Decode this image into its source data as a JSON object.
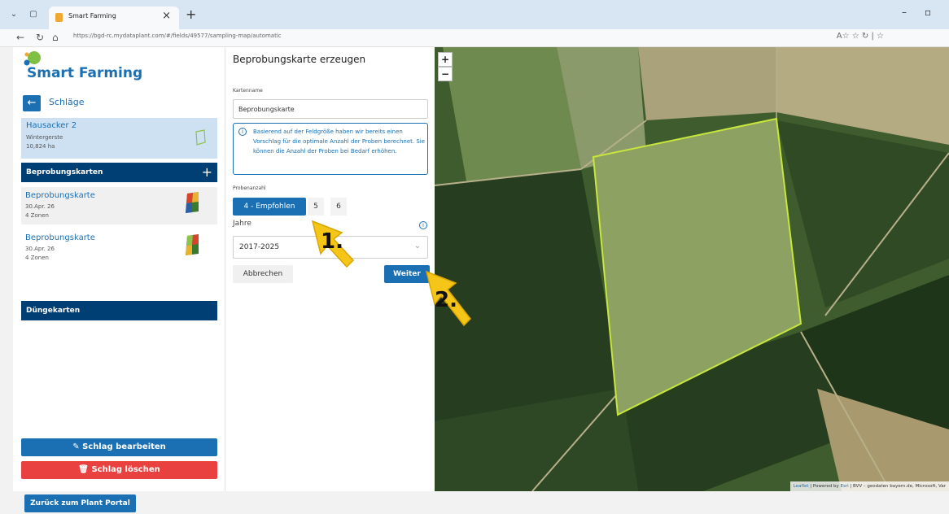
{
  "browser": {
    "tab_title": "Smart Farming",
    "url": "https://bgd-rc.mydataplant.com/#/fields/49577/sampling-map/automatic",
    "tab_close": "×",
    "new_tab": "+"
  },
  "sidebar": {
    "logo_text": "Smart Farming",
    "back_icon": "←",
    "back_label": "Schläge",
    "field": {
      "name": "Hausacker 2",
      "crop": "Wintergerste",
      "area": "10,824 ha"
    },
    "sampling_section": {
      "label": "Beprobungskarten",
      "add": "+"
    },
    "sampling_maps": [
      {
        "title": "Beprobungskarte",
        "date": "30.Apr. 26",
        "zones": "4 Zonen"
      },
      {
        "title": "Beprobungskarte",
        "date": "30.Apr. 26",
        "zones": "4 Zonen"
      }
    ],
    "fertilizer_section": {
      "label": "Düngekarten"
    },
    "edit_button": "Schlag bearbeiten",
    "delete_button": "Schlag löschen"
  },
  "form": {
    "title": "Beprobungskarte erzeugen",
    "name_label": "Kartenname",
    "name_value": "Beprobungskarte",
    "info_text": "Basierend auf der Feldgröße haben wir bereits einen Vorschlag für die optimale Anzahl der Proben berechnet. Sie können die Anzahl der Proben bei Bedarf erhöhen.",
    "samples_label": "Probenanzahl",
    "sample_options": [
      "4 - Empfohlen",
      "5",
      "6"
    ],
    "years_label": "Jahre",
    "years_value": "2017-2025",
    "cancel_button": "Abbrechen",
    "next_button": "Weiter"
  },
  "map": {
    "zoom_in": "+",
    "zoom_out": "−",
    "attribution_leaflet": "Leaflet",
    "attribution_powered": "| Powered by",
    "attribution_esri": "Esri",
    "attribution_rest": "| BVV – geodaten bayern.de, Microsoft, Var"
  },
  "annotations": {
    "step1": "1.",
    "step2": "2."
  },
  "footer": {
    "portal_button": "Zurück zum Plant Portal"
  },
  "colors": {
    "primary": "#1b6fb3",
    "dark": "#003f73",
    "danger": "#e8413f",
    "field_outline": "#c8e63c"
  }
}
